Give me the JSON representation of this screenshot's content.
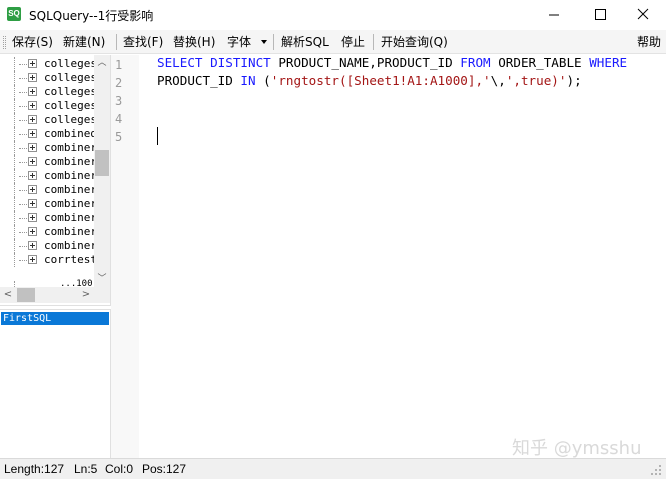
{
  "window": {
    "icon_label": "SQ",
    "title": "SQLQuery--1行受影响",
    "accent": "#2e9e44"
  },
  "toolbar": {
    "save": "保存(S)",
    "new": "新建(N)",
    "find": "查找(F)",
    "replace": "替换(H)",
    "font": "字体",
    "parse": "解析SQL",
    "stop": "停止",
    "start_query": "开始查询(Q)",
    "help": "帮助"
  },
  "tree": {
    "items": [
      "colleges",
      "colleges",
      "colleges",
      "colleges",
      "colleges",
      "combined",
      "combiner",
      "combiner",
      "combiner",
      "combiner",
      "combiner",
      "combiner",
      "combiner",
      "combiner",
      "corrtest"
    ],
    "partial_item": "...100"
  },
  "queries": {
    "items": [
      "FirstSQL"
    ],
    "selected_color": "#0a78d7"
  },
  "editor": {
    "line_numbers": [
      "1",
      "2",
      "3",
      "4",
      "5"
    ],
    "line1": {
      "kw1": "SELECT DISTINCT",
      "t1": " PRODUCT_NAME,PRODUCT_ID ",
      "kw2": "FROM",
      "t2": " ORDER_TABLE ",
      "kw3": "WHERE"
    },
    "line2": {
      "t1": "PRODUCT_ID ",
      "kw1": "IN",
      "t2": " (",
      "s1": "'rngtostr([Sheet1!A1:A1000],'",
      "t3": "\\,",
      "s2": "',true)'",
      "t4": ");"
    },
    "keyword_color": "#1a1aff",
    "string_color": "#a31515"
  },
  "watermark": "知乎 @ymsshu",
  "status": {
    "length": "Length:127",
    "ln": "Ln:5",
    "col": "Col:0",
    "pos": "Pos:127"
  }
}
